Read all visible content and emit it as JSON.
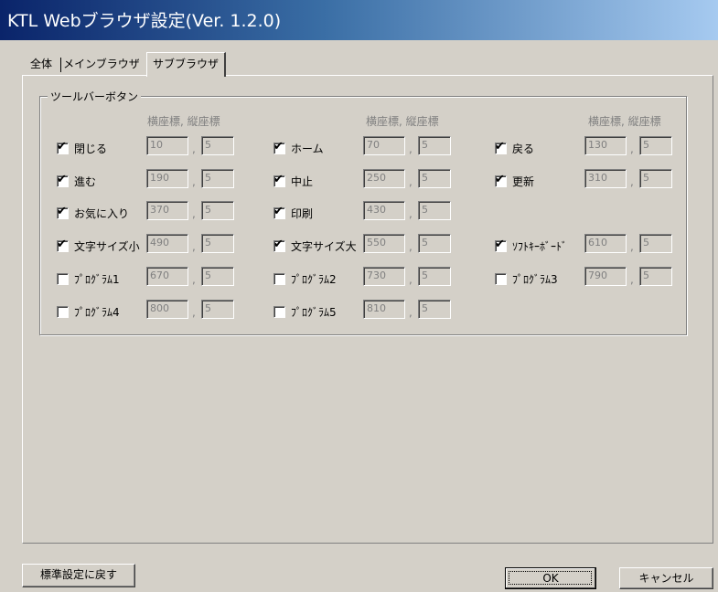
{
  "window": {
    "title": "KTL Webブラウザ設定(Ver. 1.2.0)"
  },
  "tabs": [
    "全体",
    "メインブラウザ",
    "サブブラウザ"
  ],
  "group": {
    "legend": "ツールバーボタン",
    "coord_header": "横座標, 縦座標"
  },
  "items": [
    {
      "label": "閉じる",
      "checked": true,
      "x": "10",
      "y": "5"
    },
    {
      "label": "ホーム",
      "checked": true,
      "x": "70",
      "y": "5"
    },
    {
      "label": "戻る",
      "checked": true,
      "x": "130",
      "y": "5"
    },
    {
      "label": "進む",
      "checked": true,
      "x": "190",
      "y": "5"
    },
    {
      "label": "中止",
      "checked": true,
      "x": "250",
      "y": "5"
    },
    {
      "label": "更新",
      "checked": true,
      "x": "310",
      "y": "5"
    },
    {
      "label": "お気に入り",
      "checked": true,
      "x": "370",
      "y": "5"
    },
    {
      "label": "印刷",
      "checked": true,
      "x": "430",
      "y": "5"
    },
    {
      "label": "文字サイズ小",
      "checked": true,
      "x": "490",
      "y": "5"
    },
    {
      "label": "文字サイズ大",
      "checked": true,
      "x": "550",
      "y": "5"
    },
    {
      "label": "ｿﾌﾄｷｰﾎﾞｰﾄﾞ",
      "checked": true,
      "x": "610",
      "y": "5"
    },
    {
      "label": "ﾌﾟﾛｸﾞﾗﾑ1",
      "checked": false,
      "x": "670",
      "y": "5"
    },
    {
      "label": "ﾌﾟﾛｸﾞﾗﾑ2",
      "checked": false,
      "x": "730",
      "y": "5"
    },
    {
      "label": "ﾌﾟﾛｸﾞﾗﾑ3",
      "checked": false,
      "x": "790",
      "y": "5"
    },
    {
      "label": "ﾌﾟﾛｸﾞﾗﾑ4",
      "checked": false,
      "x": "800",
      "y": "5"
    },
    {
      "label": "ﾌﾟﾛｸﾞﾗﾑ5",
      "checked": false,
      "x": "810",
      "y": "5"
    }
  ],
  "separator": ",",
  "check_mark": "✔",
  "buttons": {
    "reset": "標準設定に戻す",
    "ok": "OK",
    "cancel": "キャンセル"
  }
}
